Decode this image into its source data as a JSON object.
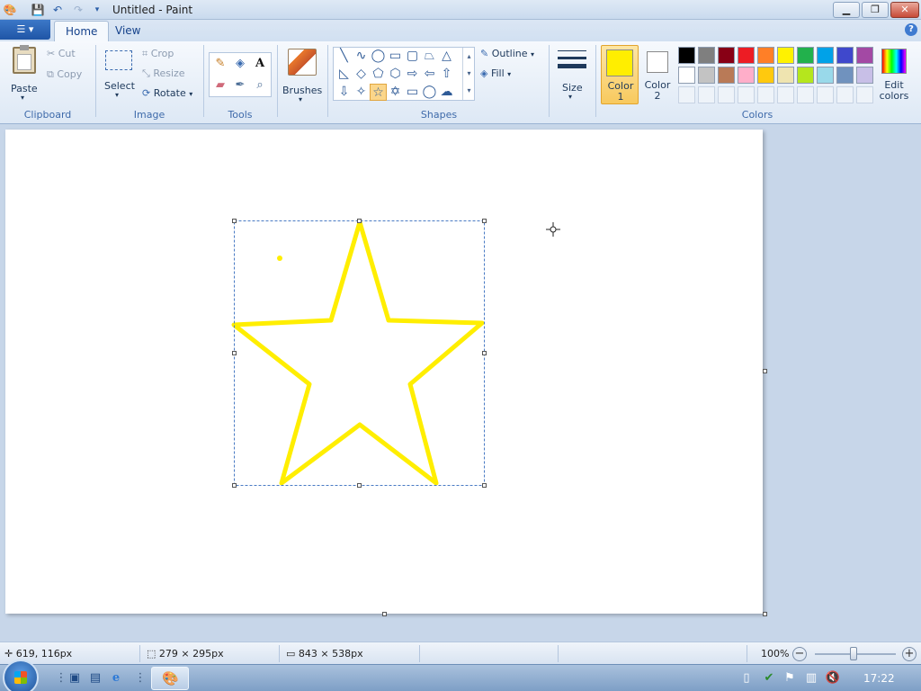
{
  "window": {
    "title": "Untitled - Paint"
  },
  "tabs": [
    {
      "label": "Home"
    },
    {
      "label": "View"
    }
  ],
  "clipboard": {
    "paste": "Paste",
    "cut": "Cut",
    "copy": "Copy",
    "group": "Clipboard"
  },
  "image": {
    "select": "Select",
    "crop": "Crop",
    "resize": "Resize",
    "rotate": "Rotate",
    "group": "Image"
  },
  "tools": {
    "group": "Tools",
    "text_tool": "A"
  },
  "brushes": {
    "label": "Brushes"
  },
  "shapes": {
    "outline": "Outline",
    "fill": "Fill",
    "group": "Shapes"
  },
  "size": {
    "label": "Size"
  },
  "colors": {
    "color1_line1": "Color",
    "color1_line2": "1",
    "color2_line1": "Color",
    "color2_line2": "2",
    "edit_line1": "Edit",
    "edit_line2": "colors",
    "group": "Colors",
    "color1_value": "#ffee00",
    "color2_value": "#ffffff",
    "row1": [
      "#000000",
      "#7f7f7f",
      "#880015",
      "#ed1c24",
      "#ff7f27",
      "#fff200",
      "#22b14c",
      "#00a2e8",
      "#3f48cc",
      "#a349a4"
    ],
    "row2": [
      "#ffffff",
      "#c3c3c3",
      "#b97a57",
      "#ffaec9",
      "#ffc90e",
      "#efe4b0",
      "#b5e61d",
      "#99d9ea",
      "#7092be",
      "#c8bfe7"
    ]
  },
  "canvas": {
    "stroke_color": "#ffee00"
  },
  "status": {
    "cursor_pos": "619, 116px",
    "selection_size": "279 × 295px",
    "image_size": "843 × 538px",
    "zoom": "100%"
  },
  "taskbar": {
    "clock": "17:22"
  }
}
